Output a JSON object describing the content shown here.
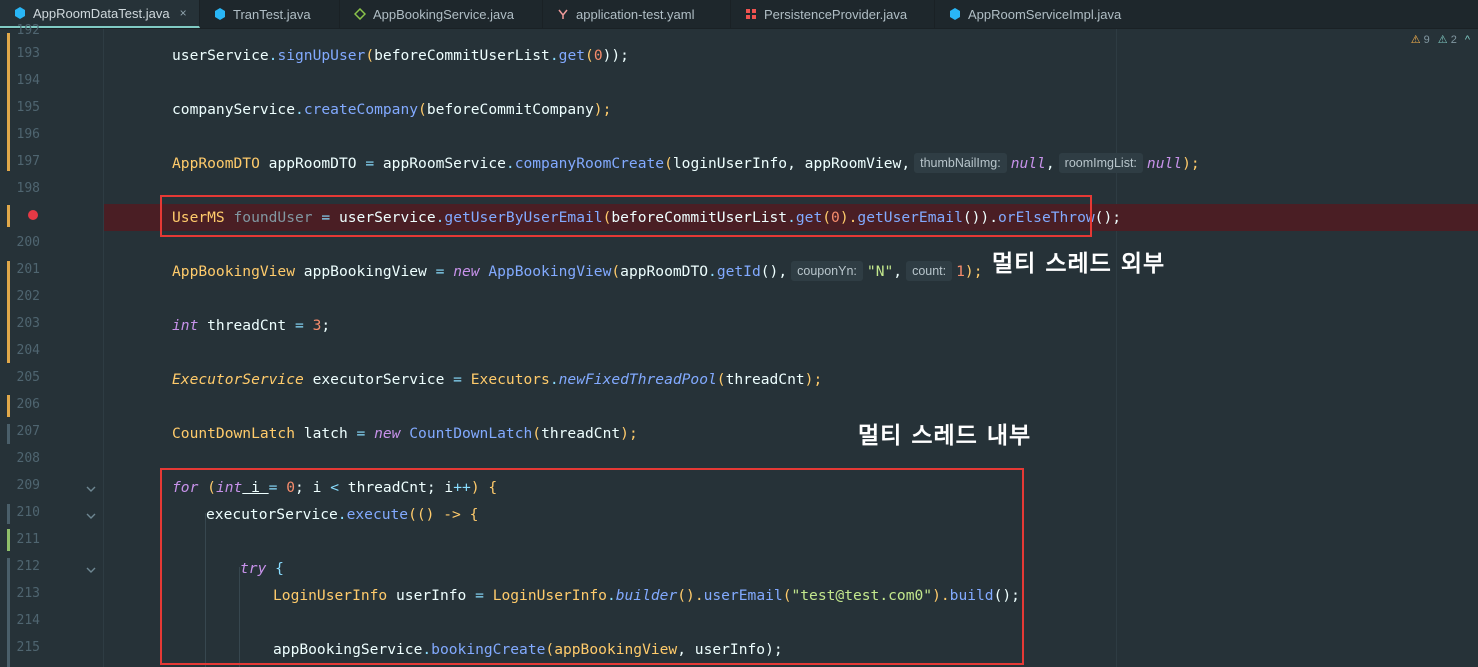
{
  "tabs": [
    {
      "label": "AppRoomDataTest.java",
      "icon": "java-class-icon",
      "active": true,
      "closable": true
    },
    {
      "label": "TranTest.java",
      "icon": "java-class-icon",
      "active": false
    },
    {
      "label": "AppBookingService.java",
      "icon": "java-interface-icon",
      "active": false
    },
    {
      "label": "application-test.yaml",
      "icon": "yaml-file-icon",
      "active": false
    },
    {
      "label": "PersistenceProvider.java",
      "icon": "java-annotation-icon",
      "active": false
    },
    {
      "label": "AppRoomServiceImpl.java",
      "icon": "java-class-icon",
      "active": false
    }
  ],
  "close_glyph": "×",
  "inspections": {
    "warnings": "9",
    "weak_warnings": "2",
    "warn_glyph": "⚠",
    "weak_glyph": "⚠",
    "nav_up": "^"
  },
  "line_numbers": [
    "192",
    "193",
    "194",
    "195",
    "196",
    "197",
    "198",
    "199",
    "200",
    "201",
    "202",
    "203",
    "204",
    "205",
    "206",
    "207",
    "208",
    "209",
    "210",
    "211",
    "212",
    "213",
    "214",
    "215"
  ],
  "breakpoint_line": "199",
  "annotations": {
    "outside_thread": "멀티 스레드 외부",
    "inside_thread": "멀티 스레드 내부"
  },
  "code": {
    "l193": [
      "userService",
      ".",
      "signUpUser",
      "(",
      "beforeCommitUserList",
      ".",
      "get",
      "(",
      "0",
      "));"
    ],
    "l195": [
      "companyService",
      ".",
      "createCompany",
      "(",
      "beforeCommitCompany",
      ");"
    ],
    "l197": [
      "AppRoomDTO",
      " appRoomDTO ",
      "=",
      " appRoomService",
      ".",
      "companyRoomCreate",
      "(",
      "loginUserInfo, appRoomView,",
      "thumbNailImg:",
      "null",
      ",",
      "roomImgList:",
      "null",
      ");"
    ],
    "l199": [
      "UserMS",
      " foundUser ",
      "=",
      " userService",
      ".",
      "getUserByUserEmail",
      "(",
      "beforeCommitUserList",
      ".",
      "get",
      "(",
      "0",
      ").",
      "getUserEmail",
      "()).",
      "orElseThrow",
      "();"
    ],
    "l201": [
      "AppBookingView",
      " appBookingView ",
      "=",
      " new ",
      "AppBookingView",
      "(",
      "appRoomDTO",
      ".",
      "getId",
      "(),",
      "couponYn:",
      "\"N\"",
      ",",
      "count:",
      "1",
      ");"
    ],
    "l203": [
      "int",
      " threadCnt ",
      "=",
      " ",
      "3",
      ";"
    ],
    "l205": [
      "ExecutorService",
      " executorService ",
      "=",
      " ",
      "Executors",
      ".",
      "newFixedThreadPool",
      "(",
      "threadCnt",
      ");"
    ],
    "l207": [
      "CountDownLatch",
      " latch ",
      "=",
      " new ",
      "CountDownLatch",
      "(",
      "threadCnt",
      ");"
    ],
    "l209": [
      "for",
      " (",
      "int",
      " i ",
      "=",
      " ",
      "0",
      "; i ",
      "<",
      " threadCnt; i",
      "++",
      ") {"
    ],
    "l210": [
      "executorService",
      ".",
      "execute",
      "(() -> {"
    ],
    "l212": [
      "try",
      " {"
    ],
    "l213": [
      "LoginUserInfo",
      " userInfo ",
      "=",
      " ",
      "LoginUserInfo",
      ".",
      "builder",
      "().",
      "userEmail",
      "(",
      "\"test@test.com0\"",
      ").",
      "build",
      "();"
    ],
    "l215": [
      "appBookingService",
      ".",
      "bookingCreate",
      "(",
      "appBookingView",
      ", userInfo);"
    ]
  },
  "colors": {
    "background": "#263238",
    "keyword": "#c792ea",
    "type": "#ffcb6b",
    "method": "#82aaff",
    "number": "#f78c6c",
    "string": "#c3e88d",
    "highlight_box": "#e53935",
    "breakpoint": "#e53945"
  }
}
